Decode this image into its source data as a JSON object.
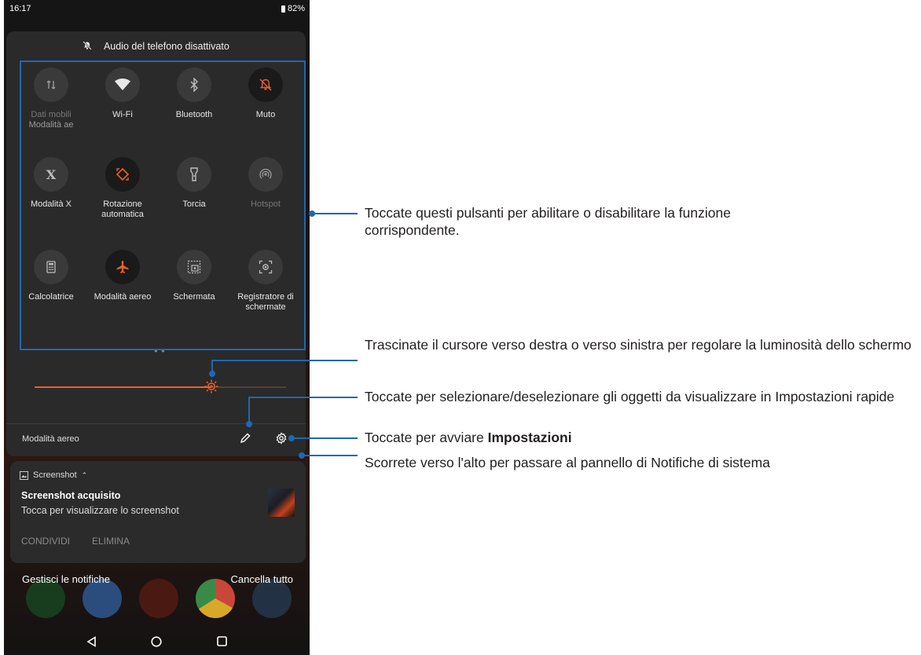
{
  "status_bar": {
    "time": "16:17",
    "battery": "82%"
  },
  "panel": {
    "audio_status": "Audio del telefono disattivato",
    "tiles": [
      {
        "label": "Dati mobili",
        "sublabel": "Modalità ae",
        "icon": "mobile-data-icon",
        "dimmed": true
      },
      {
        "label": "Wi-Fi",
        "icon": "wifi-icon"
      },
      {
        "label": "Bluetooth",
        "icon": "bluetooth-icon"
      },
      {
        "label": "Muto",
        "icon": "mute-icon",
        "active": true
      },
      {
        "label": "Modalità X",
        "icon": "x-mode-icon"
      },
      {
        "label": "Rotazione automatica",
        "icon": "auto-rotate-icon",
        "active": true
      },
      {
        "label": "Torcia",
        "icon": "flashlight-icon"
      },
      {
        "label": "Hotspot",
        "icon": "hotspot-icon",
        "dimmed": true
      },
      {
        "label": "Calcolatrice",
        "icon": "calculator-icon"
      },
      {
        "label": "Modalità aereo",
        "icon": "airplane-icon",
        "active": true
      },
      {
        "label": "Schermata",
        "icon": "screenshot-icon"
      },
      {
        "label": "Registratore di schermate",
        "icon": "screen-recorder-icon"
      }
    ],
    "brightness_level": 0.7,
    "footer_label": "Modalità aereo"
  },
  "notification": {
    "app": "Screenshot",
    "title": "Screenshot acquisito",
    "body": "Tocca per visualizzare lo screenshot",
    "actions": [
      "CONDIVIDI",
      "ELIMINA"
    ]
  },
  "bottom": {
    "manage": "Gestisci le notifiche",
    "clear_all": "Cancella tutto"
  },
  "callouts": {
    "tiles": "Toccate questi pulsanti per abilitare o disabilitare la funzione corrispondente.",
    "brightness": "Trascinate il cursore verso destra o verso sinistra per regolare la luminosità dello schermo",
    "edit": "Toccate per selezionare/deselezionare gli oggetti da visualizzare in Impostazioni rapide",
    "settings_prefix": "Toccate per avviare ",
    "settings_bold": "Impostazioni",
    "swipe": "Scorrete verso l'alto per passare al pannello di Notifiche di sistema"
  },
  "colors": {
    "accent": "#e9602d",
    "annotation": "#1e68b2",
    "panel": "#2a2a2a"
  }
}
